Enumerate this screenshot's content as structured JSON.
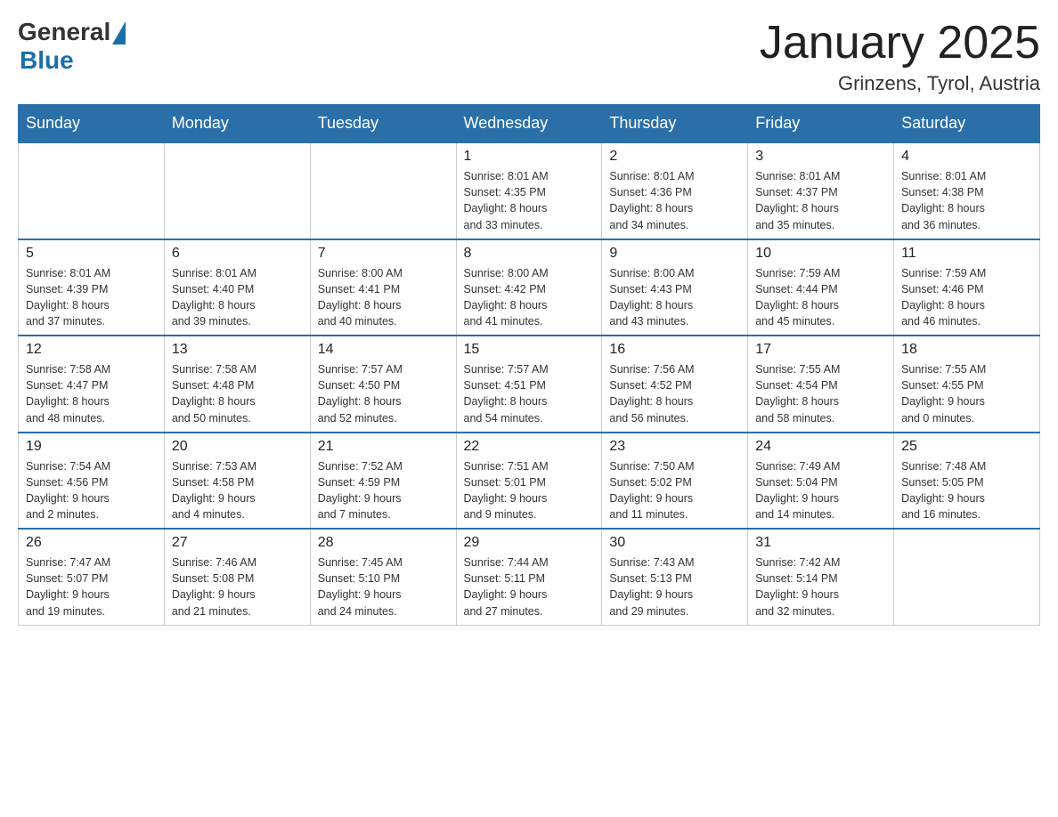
{
  "header": {
    "logo_general": "General",
    "logo_blue": "Blue",
    "title": "January 2025",
    "subtitle": "Grinzens, Tyrol, Austria"
  },
  "weekdays": [
    "Sunday",
    "Monday",
    "Tuesday",
    "Wednesday",
    "Thursday",
    "Friday",
    "Saturday"
  ],
  "weeks": [
    [
      {
        "day": "",
        "info": ""
      },
      {
        "day": "",
        "info": ""
      },
      {
        "day": "",
        "info": ""
      },
      {
        "day": "1",
        "info": "Sunrise: 8:01 AM\nSunset: 4:35 PM\nDaylight: 8 hours\nand 33 minutes."
      },
      {
        "day": "2",
        "info": "Sunrise: 8:01 AM\nSunset: 4:36 PM\nDaylight: 8 hours\nand 34 minutes."
      },
      {
        "day": "3",
        "info": "Sunrise: 8:01 AM\nSunset: 4:37 PM\nDaylight: 8 hours\nand 35 minutes."
      },
      {
        "day": "4",
        "info": "Sunrise: 8:01 AM\nSunset: 4:38 PM\nDaylight: 8 hours\nand 36 minutes."
      }
    ],
    [
      {
        "day": "5",
        "info": "Sunrise: 8:01 AM\nSunset: 4:39 PM\nDaylight: 8 hours\nand 37 minutes."
      },
      {
        "day": "6",
        "info": "Sunrise: 8:01 AM\nSunset: 4:40 PM\nDaylight: 8 hours\nand 39 minutes."
      },
      {
        "day": "7",
        "info": "Sunrise: 8:00 AM\nSunset: 4:41 PM\nDaylight: 8 hours\nand 40 minutes."
      },
      {
        "day": "8",
        "info": "Sunrise: 8:00 AM\nSunset: 4:42 PM\nDaylight: 8 hours\nand 41 minutes."
      },
      {
        "day": "9",
        "info": "Sunrise: 8:00 AM\nSunset: 4:43 PM\nDaylight: 8 hours\nand 43 minutes."
      },
      {
        "day": "10",
        "info": "Sunrise: 7:59 AM\nSunset: 4:44 PM\nDaylight: 8 hours\nand 45 minutes."
      },
      {
        "day": "11",
        "info": "Sunrise: 7:59 AM\nSunset: 4:46 PM\nDaylight: 8 hours\nand 46 minutes."
      }
    ],
    [
      {
        "day": "12",
        "info": "Sunrise: 7:58 AM\nSunset: 4:47 PM\nDaylight: 8 hours\nand 48 minutes."
      },
      {
        "day": "13",
        "info": "Sunrise: 7:58 AM\nSunset: 4:48 PM\nDaylight: 8 hours\nand 50 minutes."
      },
      {
        "day": "14",
        "info": "Sunrise: 7:57 AM\nSunset: 4:50 PM\nDaylight: 8 hours\nand 52 minutes."
      },
      {
        "day": "15",
        "info": "Sunrise: 7:57 AM\nSunset: 4:51 PM\nDaylight: 8 hours\nand 54 minutes."
      },
      {
        "day": "16",
        "info": "Sunrise: 7:56 AM\nSunset: 4:52 PM\nDaylight: 8 hours\nand 56 minutes."
      },
      {
        "day": "17",
        "info": "Sunrise: 7:55 AM\nSunset: 4:54 PM\nDaylight: 8 hours\nand 58 minutes."
      },
      {
        "day": "18",
        "info": "Sunrise: 7:55 AM\nSunset: 4:55 PM\nDaylight: 9 hours\nand 0 minutes."
      }
    ],
    [
      {
        "day": "19",
        "info": "Sunrise: 7:54 AM\nSunset: 4:56 PM\nDaylight: 9 hours\nand 2 minutes."
      },
      {
        "day": "20",
        "info": "Sunrise: 7:53 AM\nSunset: 4:58 PM\nDaylight: 9 hours\nand 4 minutes."
      },
      {
        "day": "21",
        "info": "Sunrise: 7:52 AM\nSunset: 4:59 PM\nDaylight: 9 hours\nand 7 minutes."
      },
      {
        "day": "22",
        "info": "Sunrise: 7:51 AM\nSunset: 5:01 PM\nDaylight: 9 hours\nand 9 minutes."
      },
      {
        "day": "23",
        "info": "Sunrise: 7:50 AM\nSunset: 5:02 PM\nDaylight: 9 hours\nand 11 minutes."
      },
      {
        "day": "24",
        "info": "Sunrise: 7:49 AM\nSunset: 5:04 PM\nDaylight: 9 hours\nand 14 minutes."
      },
      {
        "day": "25",
        "info": "Sunrise: 7:48 AM\nSunset: 5:05 PM\nDaylight: 9 hours\nand 16 minutes."
      }
    ],
    [
      {
        "day": "26",
        "info": "Sunrise: 7:47 AM\nSunset: 5:07 PM\nDaylight: 9 hours\nand 19 minutes."
      },
      {
        "day": "27",
        "info": "Sunrise: 7:46 AM\nSunset: 5:08 PM\nDaylight: 9 hours\nand 21 minutes."
      },
      {
        "day": "28",
        "info": "Sunrise: 7:45 AM\nSunset: 5:10 PM\nDaylight: 9 hours\nand 24 minutes."
      },
      {
        "day": "29",
        "info": "Sunrise: 7:44 AM\nSunset: 5:11 PM\nDaylight: 9 hours\nand 27 minutes."
      },
      {
        "day": "30",
        "info": "Sunrise: 7:43 AM\nSunset: 5:13 PM\nDaylight: 9 hours\nand 29 minutes."
      },
      {
        "day": "31",
        "info": "Sunrise: 7:42 AM\nSunset: 5:14 PM\nDaylight: 9 hours\nand 32 minutes."
      },
      {
        "day": "",
        "info": ""
      }
    ]
  ]
}
